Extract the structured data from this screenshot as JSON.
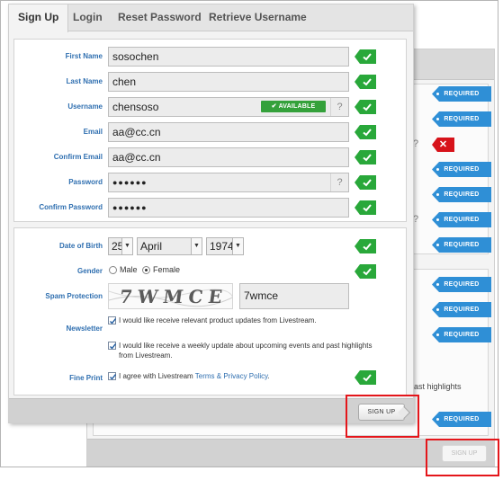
{
  "tabs": [
    {
      "label": "Sign Up",
      "active": true
    },
    {
      "label": "Login"
    },
    {
      "label": "Reset Password"
    },
    {
      "label": "Retrieve Username"
    }
  ],
  "account": {
    "first_name": {
      "label": "First Name",
      "value": "sosochen"
    },
    "last_name": {
      "label": "Last Name",
      "value": "chen"
    },
    "username": {
      "label": "Username",
      "value": "chensoso",
      "status": "AVAILABLE",
      "help": "?"
    },
    "email": {
      "label": "Email",
      "value": "aa@cc.cn"
    },
    "confirm_email": {
      "label": "Confirm Email",
      "value": "aa@cc.cn"
    },
    "password": {
      "label": "Password",
      "value": "●●●●●●",
      "help": "?"
    },
    "confirm_password": {
      "label": "Confirm Password",
      "value": "●●●●●●"
    }
  },
  "profile": {
    "dob": {
      "label": "Date of Birth",
      "day": "25",
      "month": "April",
      "year": "1974"
    },
    "gender": {
      "label": "Gender",
      "options": [
        "Male",
        "Female"
      ],
      "selected": "Female"
    },
    "spam": {
      "label": "Spam Protection",
      "captcha_image_text": "7WMCE",
      "value": "7wmce"
    },
    "newsletter": {
      "label": "Newsletter",
      "option1": "I would like receive relevant product updates from Livestream.",
      "option2_line1": "I would like receive a weekly update about upcoming events and past highlights",
      "option2_line2": "from Livestream."
    },
    "fine_print": {
      "label": "Fine Print",
      "prefix": "I agree with Livestream ",
      "link": "Terms & Privacy Policy",
      "suffix": "."
    }
  },
  "buttons": {
    "signup": "SIGN UP"
  },
  "background_form": {
    "required_label": "REQUIRED",
    "help": "?",
    "error": "✕",
    "hint": "ast highlights",
    "signup": "SIGN UP"
  },
  "colors": {
    "accent_blue": "#2f8fd6",
    "success_green": "#29a83a",
    "error_red": "#d7131a",
    "callout_red": "#e4161b"
  }
}
